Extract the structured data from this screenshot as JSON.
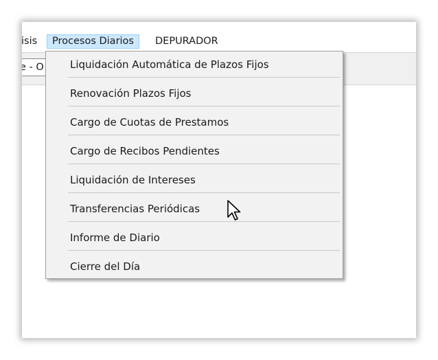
{
  "menubar": {
    "items": [
      {
        "label": "isis"
      },
      {
        "label": "Procesos Diarios"
      },
      {
        "label": "DEPURADOR"
      }
    ]
  },
  "toolbar": {
    "combo_text": "e - O"
  },
  "dropdown": {
    "items": [
      {
        "label": "Liquidación Automática de Plazos Fijos"
      },
      {
        "label": "Renovación Plazos Fijos"
      },
      {
        "label": "Cargo de Cuotas de Prestamos"
      },
      {
        "label": "Cargo de Recibos Pendientes"
      },
      {
        "label": "Liquidación de Intereses"
      },
      {
        "label": "Transferencias Periódicas"
      },
      {
        "label": "Informe de Diario"
      },
      {
        "label": "Cierre del Día"
      }
    ]
  },
  "colors": {
    "menu_highlight": "#cce8ff",
    "menu_highlight_border": "#99d1ff",
    "dropdown_bg": "#f2f2f2"
  },
  "cursor": {
    "icon": "arrow-pointer-icon"
  }
}
